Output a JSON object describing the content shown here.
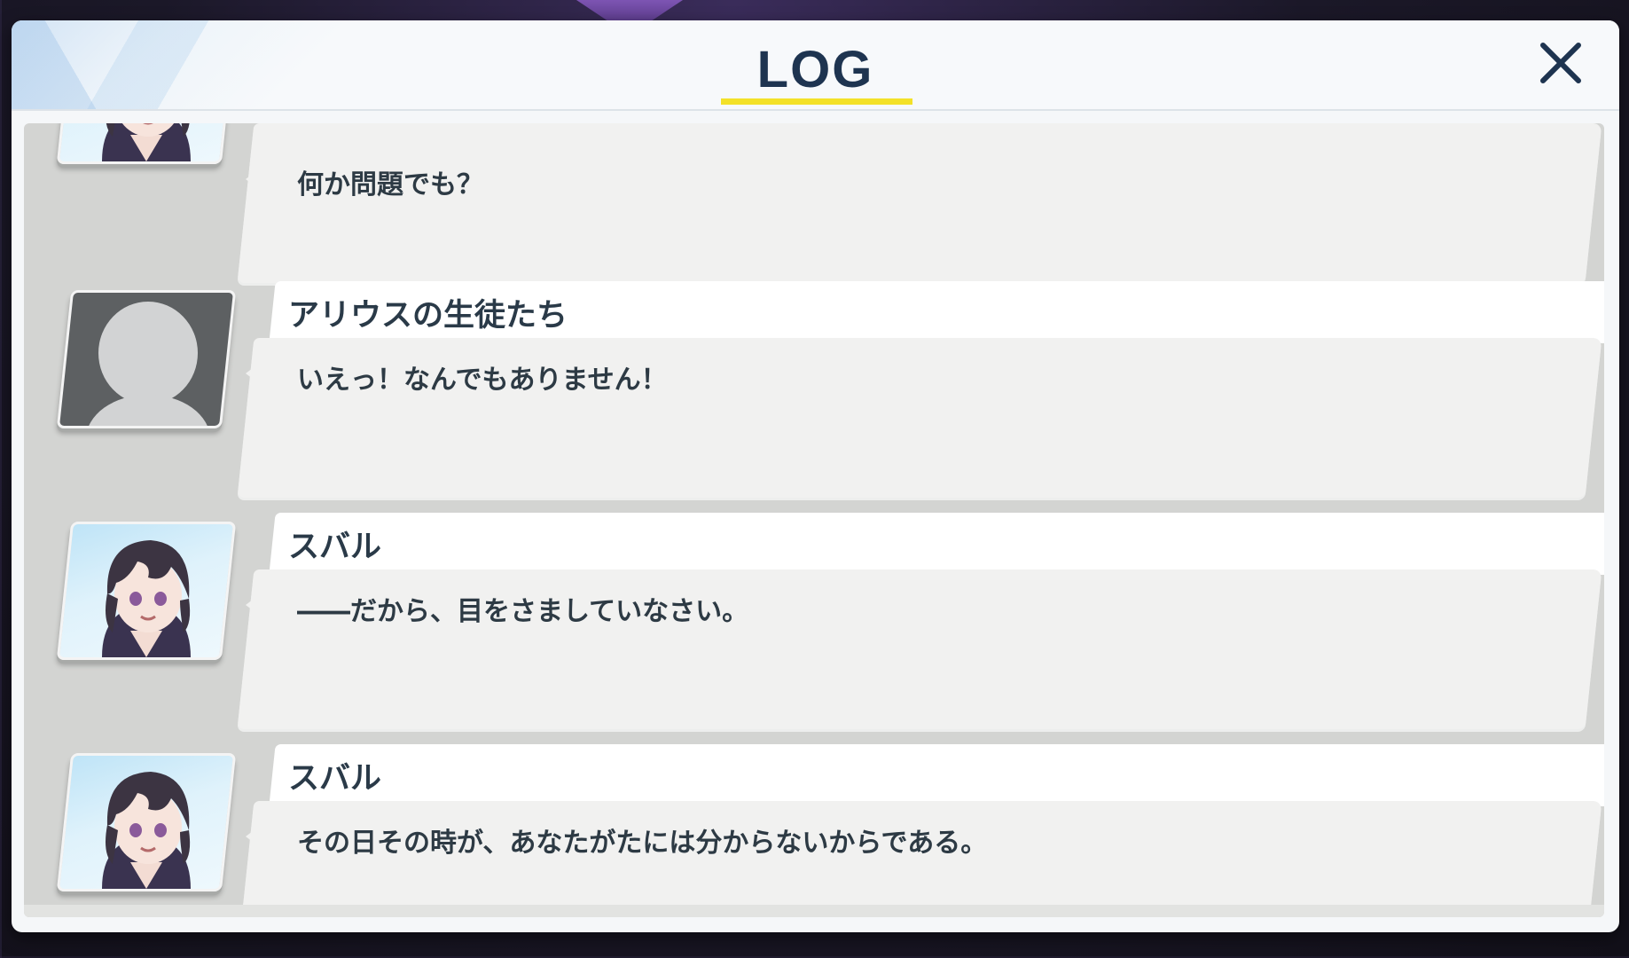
{
  "header": {
    "title": "LOG"
  },
  "entries": [
    {
      "speaker": "",
      "avatar": "character",
      "message": "何か問題でも？"
    },
    {
      "speaker": "アリウスの生徒たち",
      "avatar": "generic-silhouette",
      "message": "いえっ！なんでもありません！"
    },
    {
      "speaker": "スバル",
      "avatar": "character",
      "message": "――だから、目をさましていなさい。"
    },
    {
      "speaker": "スバル",
      "avatar": "character",
      "message": "その日その時が、あなたがたには分からないからである。"
    }
  ],
  "colors": {
    "title": "#1e3450",
    "title_underline": "#f3e128",
    "list_background": "#d3d4d2",
    "bubble": "#f1f1f0",
    "namebar": "#ffffff"
  },
  "icons": {
    "close": "close-icon",
    "generic_avatar": "person-silhouette-icon"
  }
}
